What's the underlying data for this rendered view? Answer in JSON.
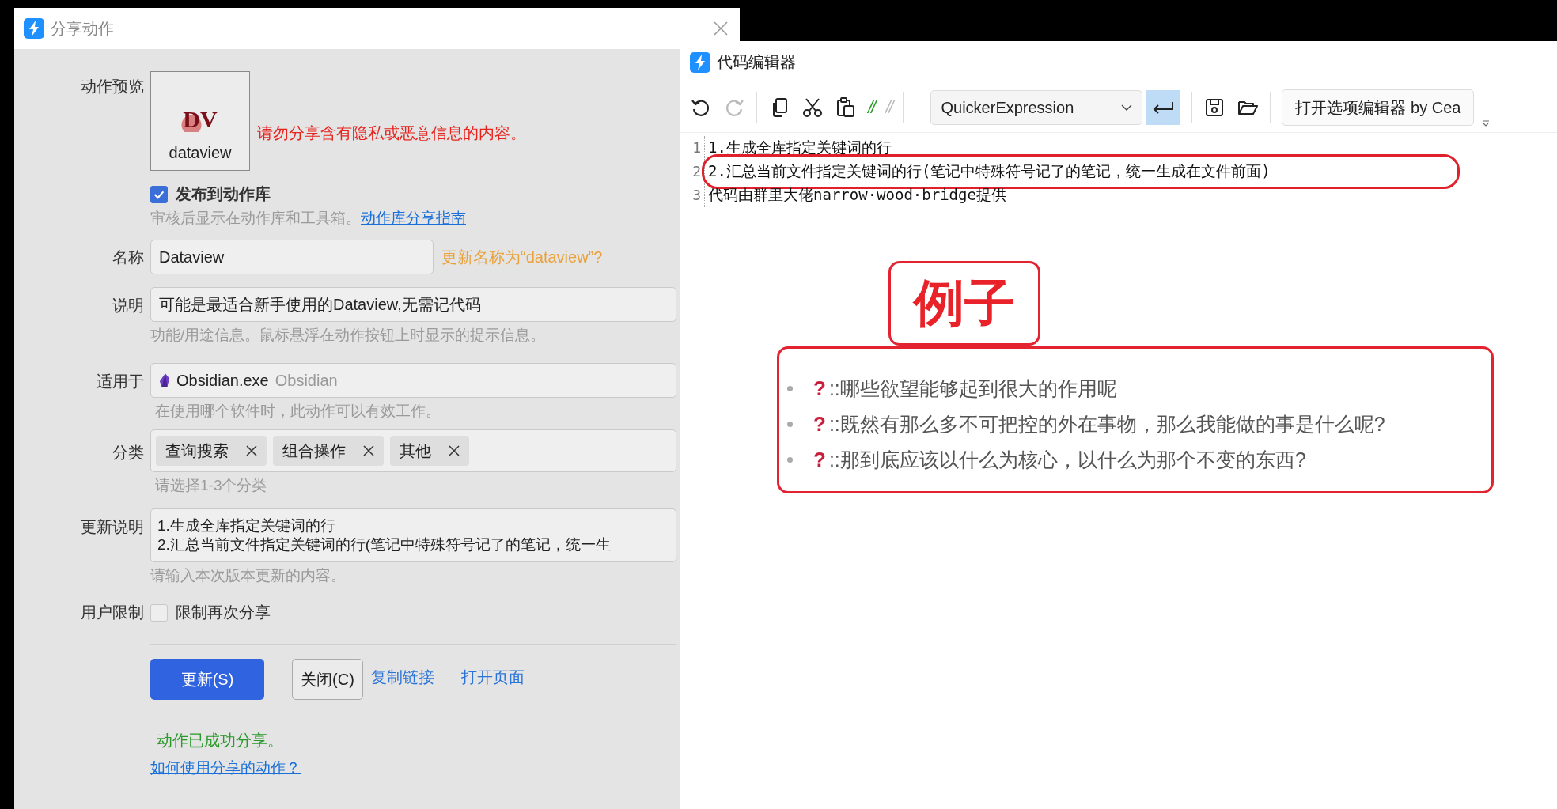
{
  "dialog": {
    "title": "分享动作",
    "preview": {
      "label": "动作预览",
      "logo_text": "DV",
      "name": "dataview"
    },
    "warning": "请勿分享含有隐私或恶意信息的内容。",
    "publish": {
      "label": "发布到动作库",
      "checked": true,
      "hint": "审核后显示在动作库和工具箱。",
      "link": "动作库分享指南"
    },
    "name": {
      "label": "名称",
      "value": "Dataview",
      "suggestion": "更新名称为“dataview”?"
    },
    "description": {
      "label": "说明",
      "value": "可能是最适合新手使用的Dataview,无需记代码",
      "hint": "功能/用途信息。鼠标悬浮在动作按钮上时显示的提示信息。"
    },
    "applies_to": {
      "label": "适用于",
      "exe": "Obsidian.exe",
      "app": "Obsidian",
      "hint": "在使用哪个软件时，此动作可以有效工作。"
    },
    "category": {
      "label": "分类",
      "tags": [
        "查询搜索",
        "组合操作",
        "其他"
      ],
      "hint": "请选择1-3个分类"
    },
    "update_notes": {
      "label": "更新说明",
      "lines": [
        "1.生成全库指定关键词的行",
        "2.汇总当前文件指定关键词的行(笔记中特殊符号记了的笔记，统一生"
      ],
      "hint": "请输入本次版本更新的内容。"
    },
    "user_limit": {
      "label": "用户限制",
      "option": "限制再次分享",
      "checked": false
    },
    "buttons": [
      {
        "label": "更新(S)",
        "kind": "primary"
      },
      {
        "label": "关闭(C)",
        "kind": "default"
      }
    ],
    "links": [
      "复制链接",
      "打开页面"
    ],
    "status": "动作已成功分享。",
    "help_link": "如何使用分享的动作？"
  },
  "editor": {
    "title": "代码编辑器",
    "toolbar": [
      {
        "kind": "undo",
        "disabled": false
      },
      {
        "kind": "redo",
        "disabled": true
      },
      {
        "kind": "separator"
      },
      {
        "kind": "copy",
        "disabled": false
      },
      {
        "kind": "cut",
        "disabled": false
      },
      {
        "kind": "paste",
        "disabled": false
      },
      {
        "kind": "comment",
        "text": "//",
        "disabled": false
      },
      {
        "kind": "comment",
        "text": "//",
        "disabled": true
      },
      {
        "kind": "separator"
      },
      {
        "kind": "dropdown",
        "value": "QuickerExpression"
      },
      {
        "kind": "wrap",
        "on": true
      },
      {
        "kind": "separator"
      },
      {
        "kind": "save",
        "disabled": false
      },
      {
        "kind": "open",
        "disabled": false
      },
      {
        "kind": "separator"
      },
      {
        "kind": "button",
        "label": "打开选项编辑器 by Cea"
      }
    ],
    "lines": [
      {
        "number": "1",
        "text": "1.生成全库指定关键词的行",
        "circled": false
      },
      {
        "number": "2",
        "text": "2.汇总当前文件指定关键词的行(笔记中特殊符号记了的笔记，统一生成在文件前面)",
        "circled": true
      },
      {
        "number": "3",
        "text": "代码由群里大佬narrow·wood·bridge提供",
        "circled": false
      }
    ]
  },
  "annotation": {
    "title": "例子",
    "items": [
      {
        "mark": "?",
        "text": "::哪些欲望能够起到很大的作用呢"
      },
      {
        "mark": "?",
        "text": "::既然有那么多不可把控的外在事物，那么我能做的事是什么呢?"
      },
      {
        "mark": "?",
        "text": "::那到底应该以什么为核心，以什么为那个不变的东西?"
      }
    ]
  }
}
